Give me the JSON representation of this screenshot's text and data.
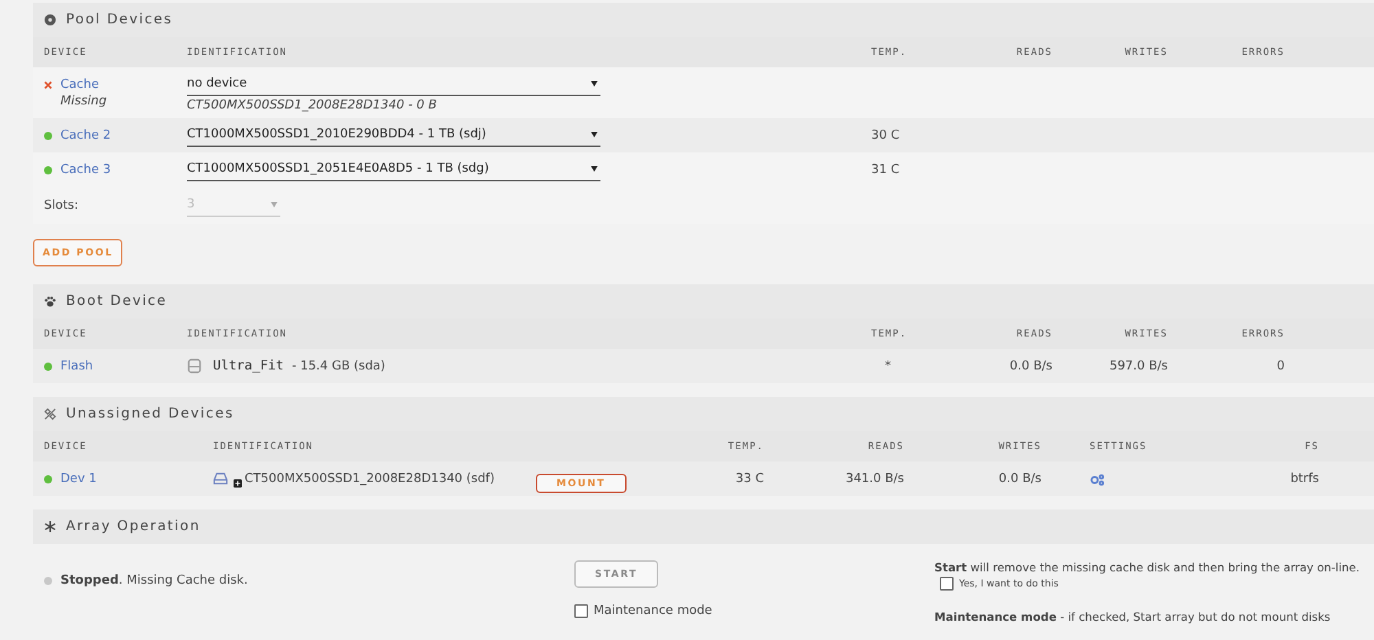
{
  "pool_devices": {
    "title": "Pool Devices",
    "columns": [
      "DEVICE",
      "IDENTIFICATION",
      "TEMP.",
      "READS",
      "WRITES",
      "ERRORS"
    ],
    "rows": [
      {
        "name": "Cache",
        "kind": "cross",
        "color": "#e0502a",
        "note": "Missing",
        "identification": "no device",
        "detail": "CT500MX500SSD1_2008E28D1340 - 0 B"
      },
      {
        "name": "Cache 2",
        "kind": "dot",
        "color": "#5fbf3f",
        "identification": "CT1000MX500SSD1_2010E290BDD4 - 1 TB (sdj)",
        "temp": "30 C"
      },
      {
        "name": "Cache 3",
        "kind": "dot",
        "color": "#5fbf3f",
        "identification": "CT1000MX500SSD1_2051E4E0A8D5 - 1 TB (sdg)",
        "temp": "31 C"
      }
    ],
    "slots": {
      "label": "Slots:",
      "value": "3",
      "disabled": true
    },
    "add_button": "ADD POOL"
  },
  "boot_device": {
    "title": "Boot Device",
    "columns": [
      "DEVICE",
      "IDENTIFICATION",
      "TEMP.",
      "READS",
      "WRITES",
      "ERRORS"
    ],
    "rows": [
      {
        "name": "Flash",
        "color": "#5fbf3f",
        "model": "Ultra_Fit",
        "size": "- 15.4 GB (sda)",
        "temp": "*",
        "reads": "0.0 B/s",
        "writes": "597.0 B/s",
        "errors": "0"
      }
    ]
  },
  "unassigned_devices": {
    "title": "Unassigned Devices",
    "columns": [
      "DEVICE",
      "IDENTIFICATION",
      "TEMP.",
      "READS",
      "WRITES",
      "SETTINGS",
      "FS"
    ],
    "rows": [
      {
        "name": "Dev 1",
        "color": "#5fbf3f",
        "identification": "CT500MX500SSD1_2008E28D1340 (sdf)",
        "button": "MOUNT",
        "temp": "33 C",
        "reads": "341.0 B/s",
        "writes": "0.0 B/s",
        "fs": "btrfs"
      }
    ]
  },
  "array_operation": {
    "title": "Array Operation",
    "status": {
      "color": "#c8c8c8",
      "text": "**Stopped**. Missing Cache disk."
    },
    "start_button": {
      "label": "START",
      "disabled": true
    },
    "maintenance_checkbox": {
      "label": "Maintenance mode",
      "checked": false
    },
    "start_note": "**Start** will remove the missing cache disk and then bring the array on-line.",
    "confirm_checkbox": {
      "label": "Yes, I want to do this",
      "checked": false
    },
    "maintenance_note": "**Maintenance mode** - if checked, Start array but do not mount disks"
  }
}
